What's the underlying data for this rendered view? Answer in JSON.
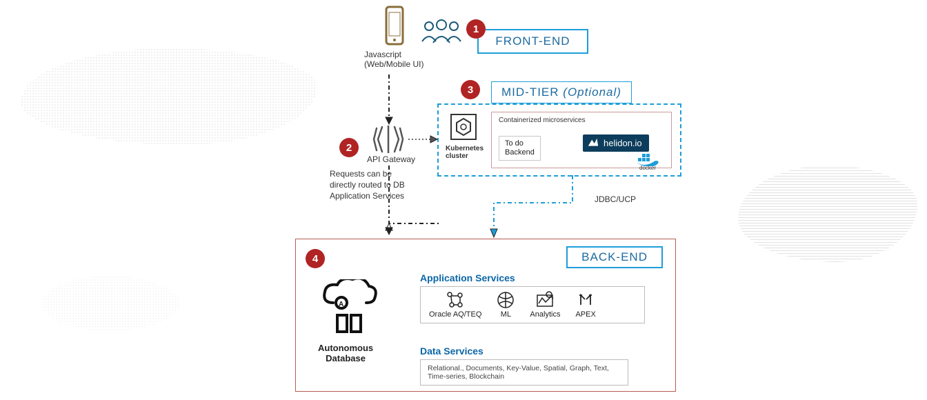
{
  "frontend": {
    "title": "FRONT-END",
    "tech_label": "Javascript\n(Web/Mobile UI)"
  },
  "api": {
    "label": "API Gateway",
    "note": "Requests can be directly routed to DB Application Services"
  },
  "midtier": {
    "title": "MID-TIER",
    "optional": "(Optional)",
    "k8s_label": "Kubernetes\ncluster",
    "micro_heading": "Containerized microservices",
    "todo": "To do\nBackend",
    "helidon": "helidon.io",
    "docker_label": "docker",
    "jdbc_label": "JDBC/UCP"
  },
  "backend": {
    "title": "BACK-END",
    "db_label": "Autonomous\nDatabase",
    "app_heading": "Application  Services",
    "services": [
      {
        "label": "Oracle AQ/TEQ"
      },
      {
        "label": "ML"
      },
      {
        "label": "Analytics"
      },
      {
        "label": "APEX"
      }
    ],
    "data_heading": "Data Services",
    "data_text": "Relational., Documents, Key-Value, Spatial, Graph, Text, Time-series, Blockchain"
  },
  "badges": {
    "one": "1",
    "two": "2",
    "three": "3",
    "four": "4"
  }
}
